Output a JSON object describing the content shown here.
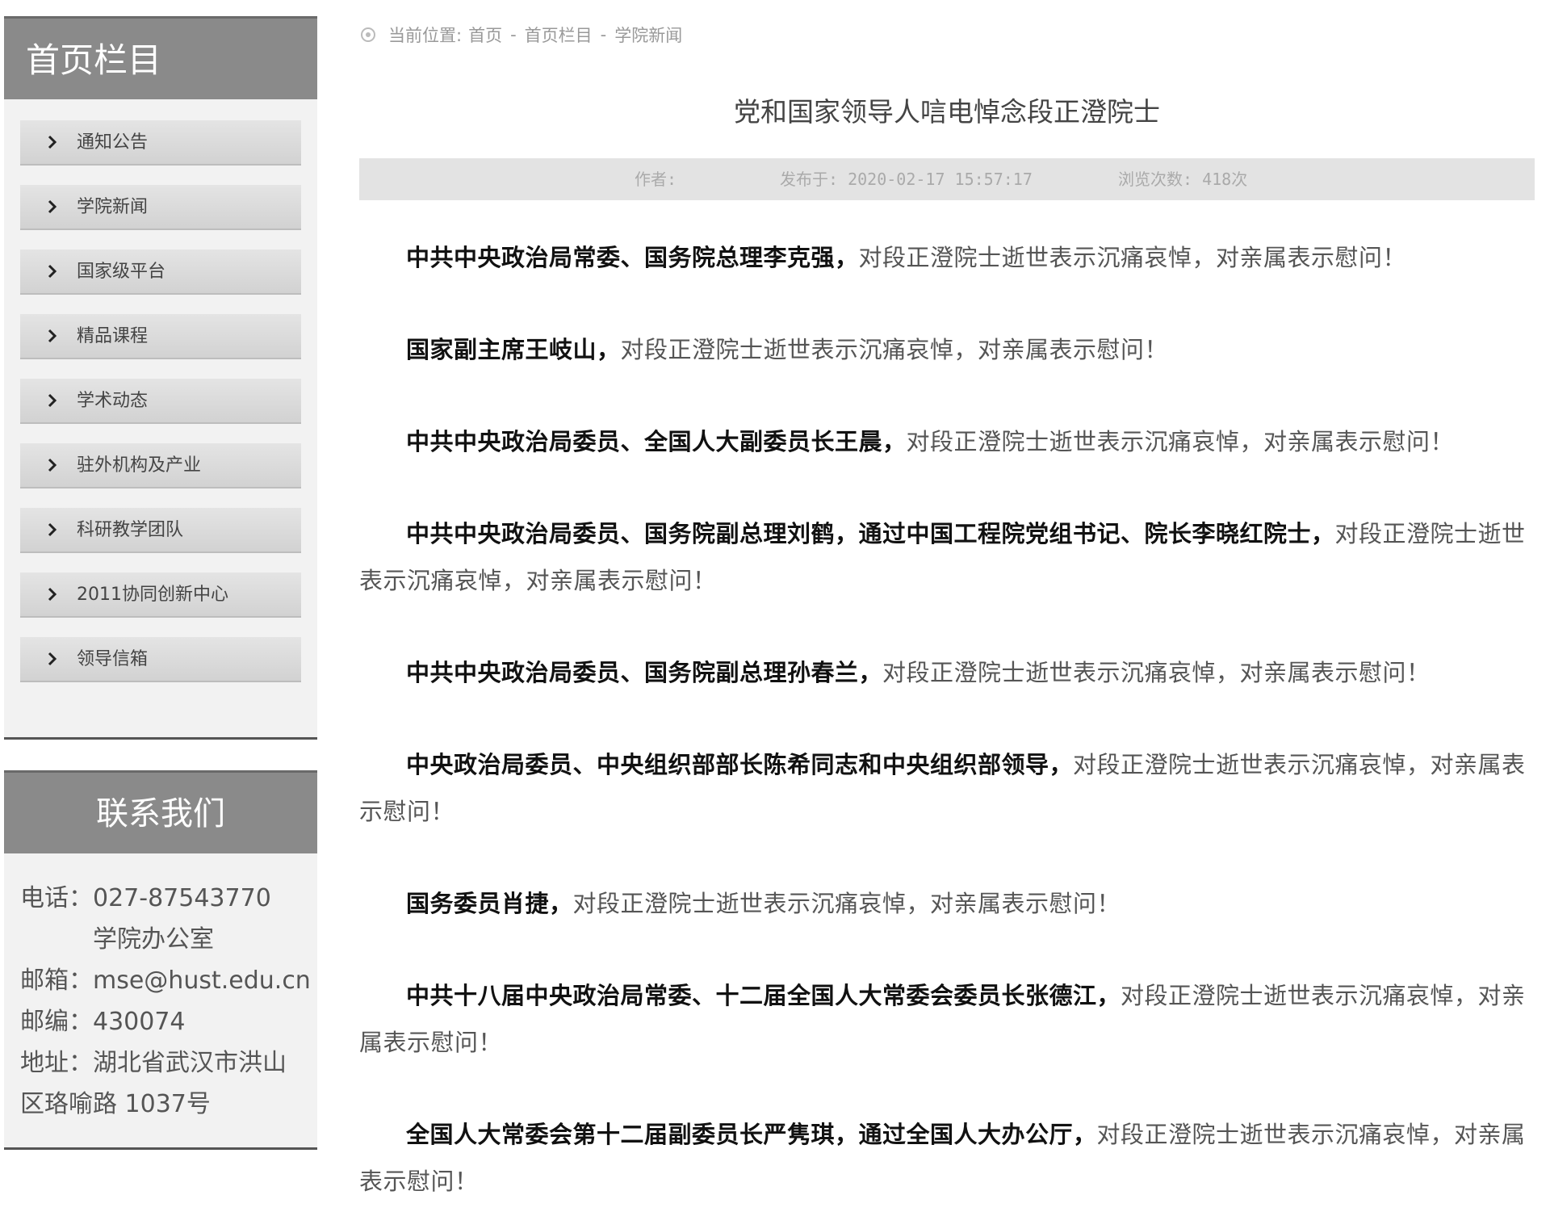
{
  "sidebar": {
    "nav_title": "首页栏目",
    "items": [
      {
        "label": "通知公告"
      },
      {
        "label": "学院新闻"
      },
      {
        "label": "国家级平台"
      },
      {
        "label": "精品课程"
      },
      {
        "label": "学术动态"
      },
      {
        "label": "驻外机构及产业"
      },
      {
        "label": "科研教学团队"
      },
      {
        "label": "2011协同创新中心"
      },
      {
        "label": "领导信箱"
      }
    ],
    "contact": {
      "title": "联系我们",
      "phone_label": "电话：",
      "phone": "027-87543770",
      "office": "学院办公室",
      "email_label": "邮箱：",
      "email": "mse@hust.edu.cn",
      "postcode_label": "邮编：",
      "postcode": "430074",
      "address_label": "地址：",
      "address_line1": "湖北省武汉市洪山",
      "address_line2": "区珞喻路 1037号"
    }
  },
  "breadcrumb": {
    "prefix": "当前位置:",
    "items": [
      "首页",
      "首页栏目",
      "学院新闻"
    ],
    "separator": "-"
  },
  "article": {
    "title": "党和国家领导人唁电悼念段正澄院士",
    "meta": {
      "author": "作者:",
      "published": "发布于: 2020-02-17 15:57:17",
      "views": "浏览次数: 418次"
    },
    "paragraphs": [
      {
        "bold": "中共中央政治局常委、国务院总理李克强，",
        "text": "对段正澄院士逝世表示沉痛哀悼，对亲属表示慰问！"
      },
      {
        "bold": "国家副主席王岐山，",
        "text": "对段正澄院士逝世表示沉痛哀悼，对亲属表示慰问！"
      },
      {
        "bold": "中共中央政治局委员、全国人大副委员长王晨，",
        "text": "对段正澄院士逝世表示沉痛哀悼，对亲属表示慰问！"
      },
      {
        "bold": "中共中央政治局委员、国务院副总理刘鹤，通过中国工程院党组书记、院长李晓红院士，",
        "text": "对段正澄院士逝世表示沉痛哀悼，对亲属表示慰问！"
      },
      {
        "bold": "中共中央政治局委员、国务院副总理孙春兰，",
        "text": "对段正澄院士逝世表示沉痛哀悼，对亲属表示慰问！"
      },
      {
        "bold": "中央政治局委员、中央组织部部长陈希同志和中央组织部领导，",
        "text": "对段正澄院士逝世表示沉痛哀悼，对亲属表示慰问！"
      },
      {
        "bold": "国务委员肖捷，",
        "text": "对段正澄院士逝世表示沉痛哀悼，对亲属表示慰问！"
      },
      {
        "bold": "中共十八届中央政治局常委、十二届全国人大常委会委员长张德江，",
        "text": "对段正澄院士逝世表示沉痛哀悼，对亲属表示慰问！"
      },
      {
        "bold": "全国人大常委会第十二届副委员长严隽琪，通过全国人大办公厅，",
        "text": "对段正澄院士逝世表示沉痛哀悼，对亲属表示慰问！"
      }
    ]
  }
}
